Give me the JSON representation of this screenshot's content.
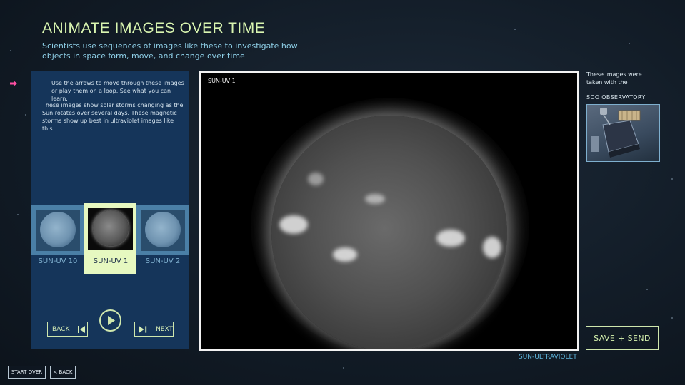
{
  "header": {
    "title": "ANIMATE IMAGES OVER TIME",
    "subtitle": "Scientists use sequences of images like these to investigate how objects in space form, move, and change over time"
  },
  "instructions": {
    "line1": "Use the arrows to move through these images or play them on a loop. See what you can learn.",
    "line2": "These images show solar storms changing as the Sun rotates over several days. These magnetic storms show up best in ultraviolet images like this."
  },
  "thumbnails": [
    {
      "label": "SUN-UV 10"
    },
    {
      "label": "SUN-UV 1"
    },
    {
      "label": "SUN-UV 2"
    }
  ],
  "controls": {
    "back_label": "BACK",
    "next_label": "NEXT",
    "play_icon": "play-icon"
  },
  "viewer": {
    "label": "SUN-UV 1",
    "caption": "SUN-ULTRAVIOLET"
  },
  "info": {
    "text": "These images were taken with the",
    "observatory": "SDO OBSERVATORY"
  },
  "actions": {
    "save_send": "SAVE + SEND"
  },
  "footer": {
    "start_over": "START OVER",
    "back": "< BACK"
  },
  "colors": {
    "accent": "#d9f5b0",
    "panel": "#15355a",
    "thumb_frame": "#4a7fa6",
    "caption": "#5fb6dd",
    "pointer": "#ff4fa3"
  }
}
